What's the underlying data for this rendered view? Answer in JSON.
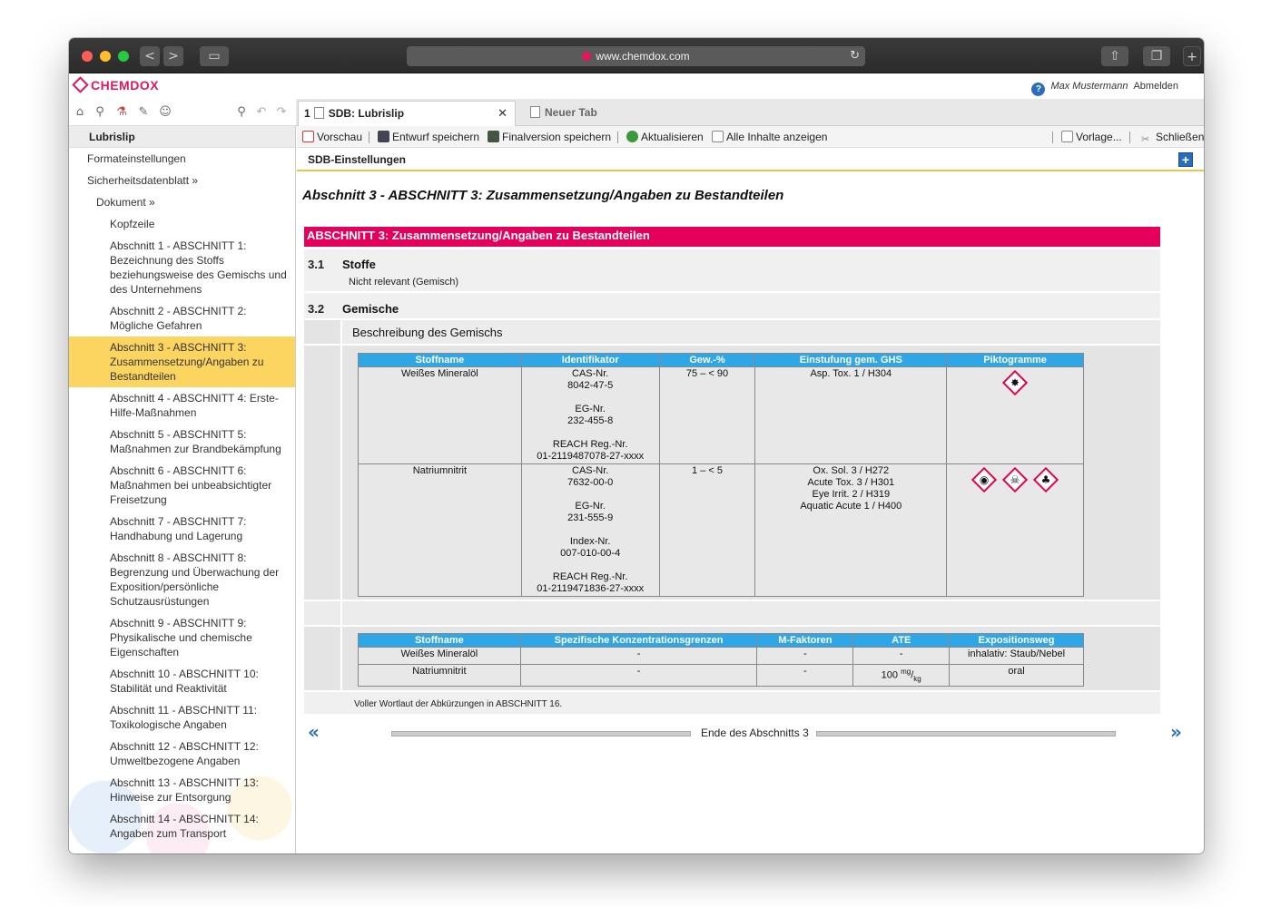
{
  "browser": {
    "url": "www.chemdox.com",
    "back": "<",
    "forward": ">"
  },
  "app": {
    "logo": "CHEMDOX",
    "user_name": "Max Mustermann",
    "logout": "Abmelden",
    "help": "?"
  },
  "tabs": {
    "active_number": "1",
    "active_label": "SDB: Lubrislip",
    "close": "✕",
    "new_tab": "Neuer Tab"
  },
  "sidebar": {
    "title": "Lubrislip",
    "items": [
      {
        "label": "Formateinstellungen"
      },
      {
        "label": "Sicherheitsdatenblatt »"
      },
      {
        "label": "Dokument »"
      },
      {
        "label": "Kopfzeile"
      },
      {
        "label": "Abschnitt 1 - ABSCHNITT 1: Bezeichnung des Stoffs beziehungsweise des Gemischs und des Unternehmens"
      },
      {
        "label": "Abschnitt 2 - ABSCHNITT 2: Mögliche Gefahren"
      },
      {
        "label": "Abschnitt 3 - ABSCHNITT 3: Zusammensetzung/Angaben zu Bestandteilen"
      },
      {
        "label": "Abschnitt 4 - ABSCHNITT 4: Erste-Hilfe-Maßnahmen"
      },
      {
        "label": "Abschnitt 5 - ABSCHNITT 5: Maßnahmen zur Brandbekämpfung"
      },
      {
        "label": "Abschnitt 6 - ABSCHNITT 6: Maßnahmen bei unbeabsichtigter Freisetzung"
      },
      {
        "label": "Abschnitt 7 - ABSCHNITT 7: Handhabung und Lagerung"
      },
      {
        "label": "Abschnitt 8 - ABSCHNITT 8: Begrenzung und Überwachung der Exposition/persönliche Schutzausrüstungen"
      },
      {
        "label": "Abschnitt 9 - ABSCHNITT 9: Physikalische und chemische Eigenschaften"
      },
      {
        "label": "Abschnitt 10 - ABSCHNITT 10: Stabilität und Reaktivität"
      },
      {
        "label": "Abschnitt 11 - ABSCHNITT 11: Toxikologische Angaben"
      },
      {
        "label": "Abschnitt 12 - ABSCHNITT 12: Umweltbezogene Angaben"
      },
      {
        "label": "Abschnitt 13 - ABSCHNITT 13: Hinweise zur Entsorgung"
      },
      {
        "label": "Abschnitt 14 - ABSCHNITT 14: Angaben zum Transport"
      }
    ]
  },
  "toolbar": {
    "preview": "Vorschau",
    "save_draft": "Entwurf speichern",
    "save_final": "Finalversion speichern",
    "refresh": "Aktualisieren",
    "show_all": "Alle Inhalte anzeigen",
    "template": "Vorlage...",
    "close": "Schließen"
  },
  "subheader": {
    "title": "SDB-Einstellungen",
    "add": "+"
  },
  "content": {
    "section_title": "Abschnitt 3 - ABSCHNITT 3: Zusammensetzung/Angaben zu Bestandteilen",
    "banner": "ABSCHNITT 3: Zusammensetzung/Angaben zu Bestandteilen",
    "s31_num": "3.1",
    "s31_title": "Stoffe",
    "s31_text": "Nicht relevant (Gemisch)",
    "s32_num": "3.2",
    "s32_title": "Gemische",
    "s32_sub": "Beschreibung des Gemischs",
    "table1": {
      "headers": [
        "Stoffname",
        "Identifikator",
        "Gew.-%",
        "Einstufung gem. GHS",
        "Piktogramme"
      ],
      "rows": [
        {
          "name": "Weißes Mineralöl",
          "id": [
            "CAS-Nr.",
            "8042-47-5",
            "",
            "EG-Nr.",
            "232-455-8",
            "",
            "REACH Reg.-Nr.",
            "01-2119487078-27-xxxx"
          ],
          "weight": "75 – < 90",
          "ghs": [
            "Asp. Tox. 1 / H304"
          ],
          "pictos": [
            "health-hazard"
          ]
        },
        {
          "name": "Natriumnitrit",
          "id": [
            "CAS-Nr.",
            "7632-00-0",
            "",
            "EG-Nr.",
            "231-555-9",
            "",
            "Index-Nr.",
            "007-010-00-4",
            "",
            "REACH Reg.-Nr.",
            "01-2119471836-27-xxxx"
          ],
          "weight": "1 – < 5",
          "ghs": [
            "Ox. Sol. 3 / H272",
            "Acute Tox. 3 / H301",
            "Eye Irrit. 2 / H319",
            "Aquatic Acute 1 / H400"
          ],
          "pictos": [
            "flame-over-circle",
            "skull-crossbones",
            "environment"
          ]
        }
      ]
    },
    "table2": {
      "headers": [
        "Stoffname",
        "Spezifische Konzentrationsgrenzen",
        "M-Faktoren",
        "ATE",
        "Expositionsweg"
      ],
      "rows": [
        {
          "name": "Weißes Mineralöl",
          "conc": "-",
          "m": "-",
          "ate": "-",
          "ate_sup": "",
          "ate_sub": "",
          "route": "inhalativ: Staub/Nebel"
        },
        {
          "name": "Natriumnitrit",
          "conc": "-",
          "m": "-",
          "ate": "100",
          "ate_sup": "mg",
          "ate_sub": "kg",
          "route": "oral"
        }
      ]
    },
    "footnote": "Voller Wortlaut der Abkürzungen in ABSCHNITT 16.",
    "section_end": "Ende des Abschnitts 3"
  },
  "colors": {
    "brand": "#e5155e",
    "banner": "#e5005c",
    "table_header": "#2fa6e6",
    "selected": "#fcd560"
  }
}
